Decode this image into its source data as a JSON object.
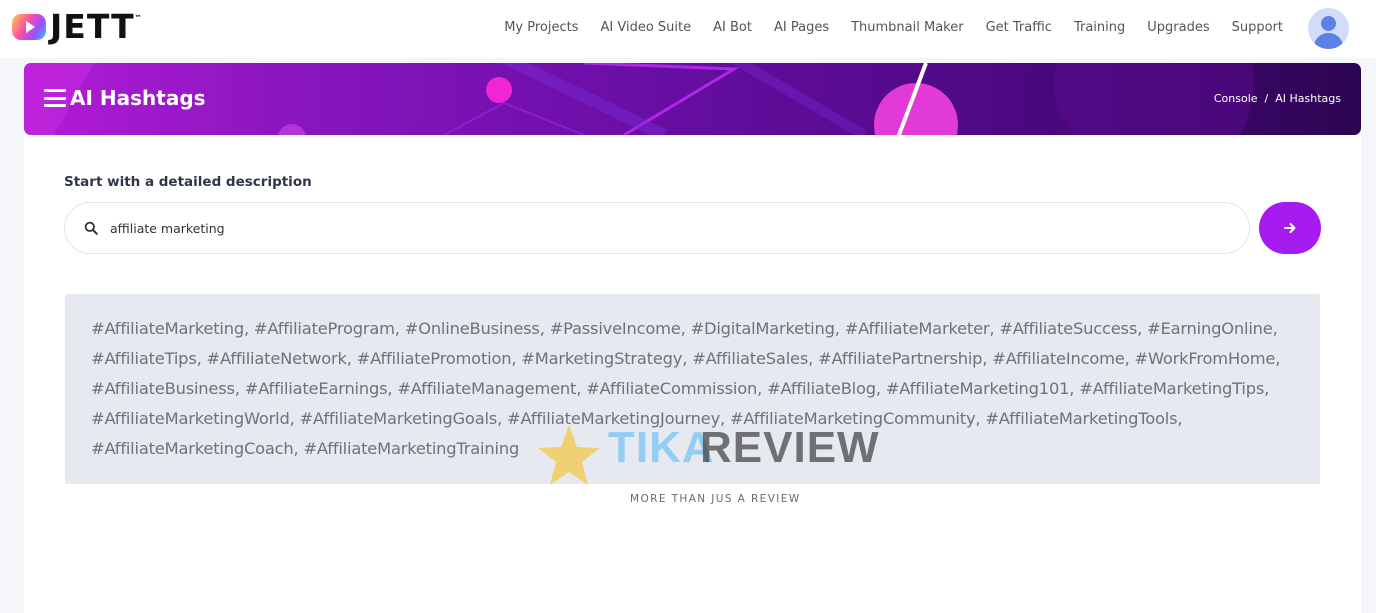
{
  "app": {
    "logo_text": "JETT",
    "logo_tm": "™"
  },
  "nav": {
    "items": [
      {
        "label": "My Projects"
      },
      {
        "label": "AI Video Suite"
      },
      {
        "label": "AI Bot"
      },
      {
        "label": "AI Pages"
      },
      {
        "label": "Thumbnail Maker"
      },
      {
        "label": "Get Traffic"
      },
      {
        "label": "Training"
      },
      {
        "label": "Upgrades"
      },
      {
        "label": "Support"
      }
    ]
  },
  "banner": {
    "title": "AI Hashtags",
    "breadcrumb": [
      "Console",
      "/",
      "AI Hashtags"
    ]
  },
  "form": {
    "label": "Start with a detailed description",
    "search_value": "affiliate marketing",
    "submit_icon": "arrow-right-icon"
  },
  "result": {
    "hashtags_text": "#AffiliateMarketing, #AffiliateProgram, #OnlineBusiness, #PassiveIncome, #DigitalMarketing, #AffiliateMarketer, #AffiliateSuccess, #EarningOnline, #AffiliateTips, #AffiliateNetwork, #AffiliatePromotion, #MarketingStrategy, #AffiliateSales, #AffiliatePartnership, #AffiliateIncome, #WorkFromHome, #AffiliateBusiness, #AffiliateEarnings, #AffiliateManagement, #AffiliateCommission, #AffiliateBlog, #AffiliateMarketing101, #AffiliateMarketingTips, #AffiliateMarketingWorld, #AffiliateMarketingGoals, #AffiliateMarketingJourney, #AffiliateMarketingCommunity, #AffiliateMarketingTools, #AffiliateMarketingCoach, #AffiliateMarketingTraining"
  },
  "watermark": {
    "brand_a": "TIKA",
    "brand_b": "REVIEW",
    "tagline": "MORE THAN JUS A REVIEW"
  },
  "colors": {
    "accent": "#a61cf0",
    "result_bg": "#e6e9ef",
    "text_muted": "#6c737c"
  }
}
